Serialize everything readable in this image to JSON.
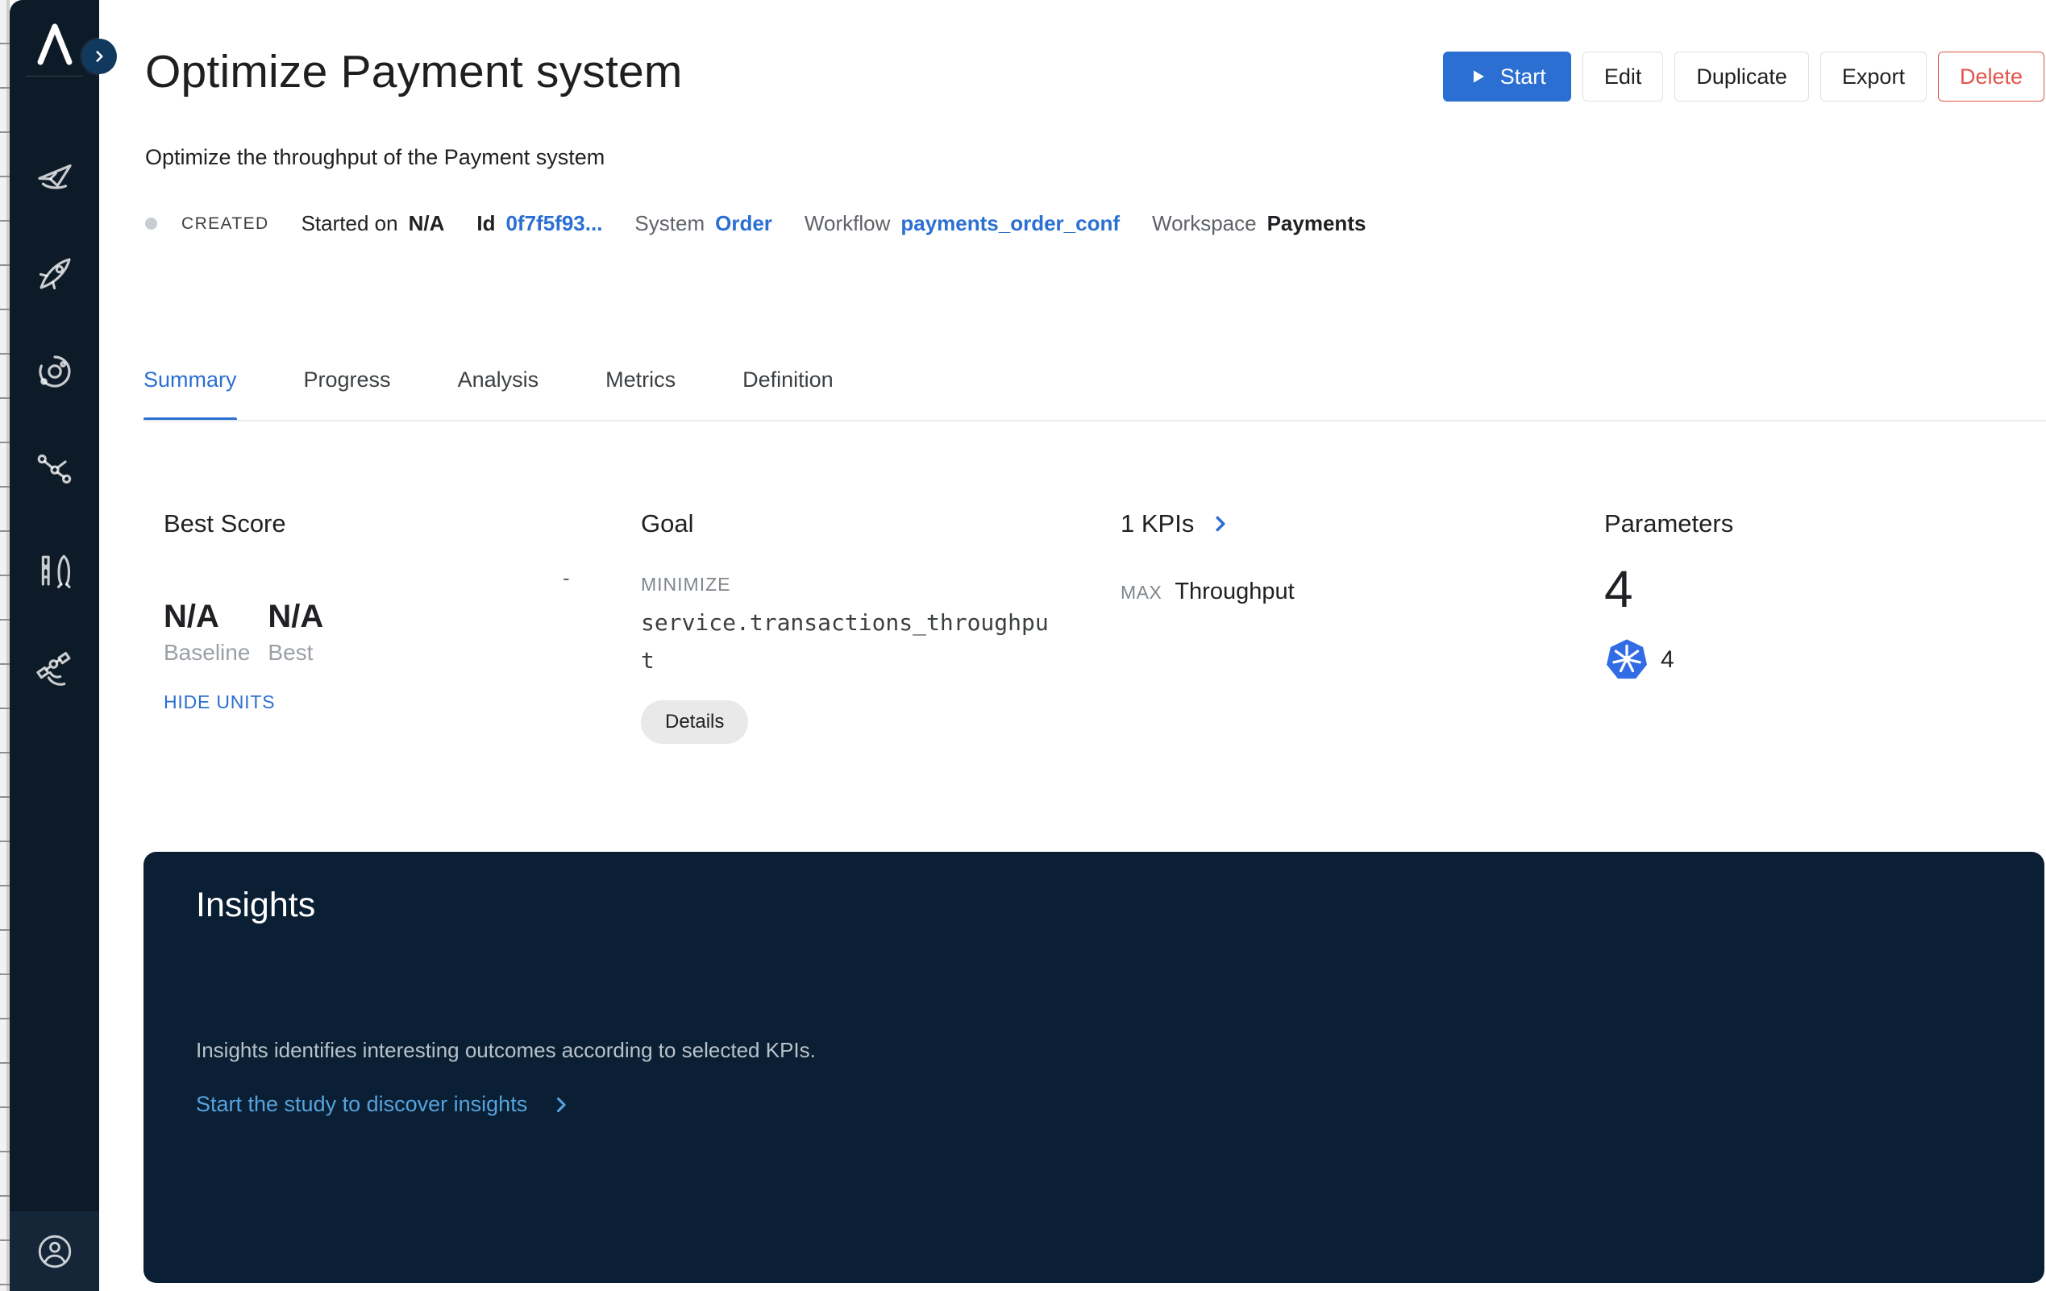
{
  "colors": {
    "accent": "#2b6fd2",
    "danger": "#e15449",
    "sidebar_bg": "#0d1a28",
    "insights_bg": "#0a1f33",
    "insights_link": "#55a3df",
    "kubernetes_blue": "#326ce5"
  },
  "sidebar": {
    "logo_icon": "lambda-logo",
    "expand_icon": "chevron-right",
    "nav_icons": [
      "shuttle",
      "rocket",
      "orbit",
      "graph",
      "launchpad",
      "satellite"
    ],
    "account_icon": "user-circle"
  },
  "header": {
    "title": "Optimize Payment system",
    "subtitle": "Optimize the throughput of the Payment system",
    "actions": {
      "start": "Start",
      "edit": "Edit",
      "duplicate": "Duplicate",
      "export": "Export",
      "delete": "Delete"
    }
  },
  "meta": {
    "status": "CREATED",
    "started_label": "Started on",
    "started_value": "N/A",
    "id_label": "Id",
    "id_value": "0f7f5f93...",
    "system_label": "System",
    "system_value": "Order",
    "workflow_label": "Workflow",
    "workflow_value": "payments_order_conf",
    "workspace_label": "Workspace",
    "workspace_value": "Payments"
  },
  "tabs": [
    {
      "label": "Summary",
      "active": true
    },
    {
      "label": "Progress",
      "active": false
    },
    {
      "label": "Analysis",
      "active": false
    },
    {
      "label": "Metrics",
      "active": false
    },
    {
      "label": "Definition",
      "active": false
    }
  ],
  "summary": {
    "best_score": {
      "heading": "Best Score",
      "placeholder": "-",
      "baseline_value": "N/A",
      "baseline_label": "Baseline",
      "best_value": "N/A",
      "best_label": "Best",
      "hide_units_label": "HIDE UNITS"
    },
    "goal": {
      "heading": "Goal",
      "direction": "MINIMIZE",
      "metric": "service.transactions_throughput",
      "details_label": "Details"
    },
    "kpis": {
      "heading": "1 KPIs",
      "direction": "MAX",
      "name": "Throughput"
    },
    "parameters": {
      "heading": "Parameters",
      "count": "4",
      "kubernetes_count": "4"
    }
  },
  "insights": {
    "title": "Insights",
    "description": "Insights identifies interesting outcomes according to selected KPIs.",
    "cta": "Start the study to discover insights"
  }
}
